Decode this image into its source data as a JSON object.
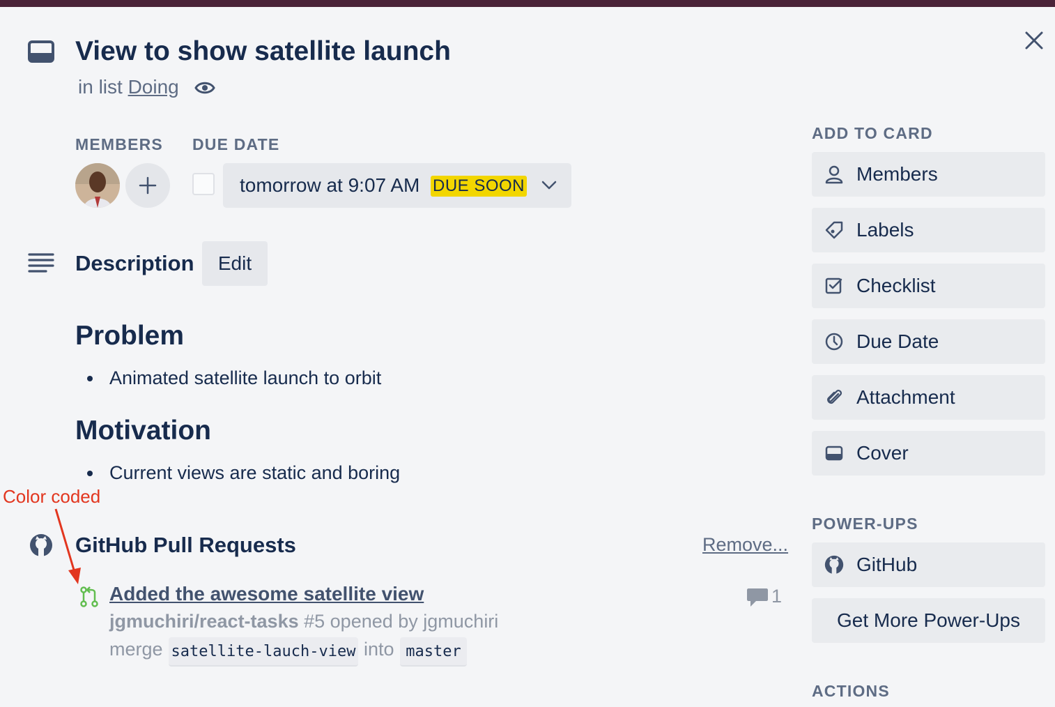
{
  "card": {
    "title": "View to show satellite launch",
    "list_prefix": "in list",
    "list_name": "Doing"
  },
  "members": {
    "label": "MEMBERS"
  },
  "due_date": {
    "label": "DUE DATE",
    "value": "tomorrow at 9:07 AM",
    "badge": "DUE SOON",
    "badge_color": "#f2d600"
  },
  "description": {
    "title": "Description",
    "edit_label": "Edit",
    "sections": [
      {
        "heading": "Problem",
        "items": [
          "Animated satellite launch to orbit"
        ]
      },
      {
        "heading": "Motivation",
        "items": [
          "Current views are static and boring"
        ]
      }
    ]
  },
  "annotation": {
    "text": "Color coded",
    "color": "#e2361f"
  },
  "github": {
    "title": "GitHub Pull Requests",
    "remove_label": "Remove...",
    "pull_request": {
      "title": "Added the awesome satellite view",
      "repo": "jgmuchiri/react-tasks",
      "subtitle": "#5 opened by jgmuchiri",
      "merge_word": "merge",
      "into_word": "into",
      "source_branch": "satellite-lauch-view",
      "target_branch": "master",
      "comment_count": "1",
      "status_color": "#61bd4f"
    }
  },
  "sidebar": {
    "add_to_card_label": "ADD TO CARD",
    "add_to_card": [
      {
        "label": "Members",
        "icon": "person-icon"
      },
      {
        "label": "Labels",
        "icon": "tag-icon"
      },
      {
        "label": "Checklist",
        "icon": "checklist-icon"
      },
      {
        "label": "Due Date",
        "icon": "clock-icon"
      },
      {
        "label": "Attachment",
        "icon": "paperclip-icon"
      },
      {
        "label": "Cover",
        "icon": "cover-icon"
      }
    ],
    "power_ups_label": "POWER-UPS",
    "power_ups": [
      {
        "label": "GitHub",
        "icon": "github-icon"
      },
      {
        "label": "Get More Power-Ups"
      }
    ],
    "actions_label": "ACTIONS"
  }
}
